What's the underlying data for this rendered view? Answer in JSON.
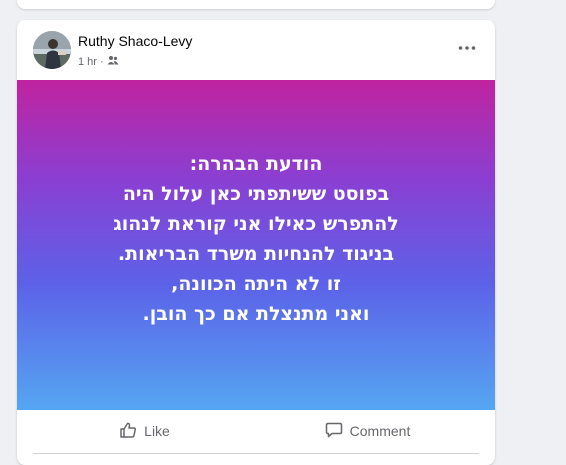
{
  "post": {
    "author": "Ruthy Shaco-Levy",
    "time": "1 hr",
    "separator": "·",
    "audience_icon": "friends-icon",
    "menu_icon": "more-dots-icon",
    "text_lines": [
      "הודעת הבהרה:",
      "בפוסט ששיתפתי כאן עלול היה",
      "להתפרש כאילו אני קוראת לנהוג",
      "בניגוד להנחיות משרד הבריאות.",
      "זו לא היתה הכוונה,",
      "ואני מתנצלת אם כך הובן."
    ],
    "background_colors": [
      "#c0239f",
      "#8a3fd2",
      "#5c62e8",
      "#55a6f2"
    ]
  },
  "actions": {
    "like_label": "Like",
    "comment_label": "Comment"
  }
}
